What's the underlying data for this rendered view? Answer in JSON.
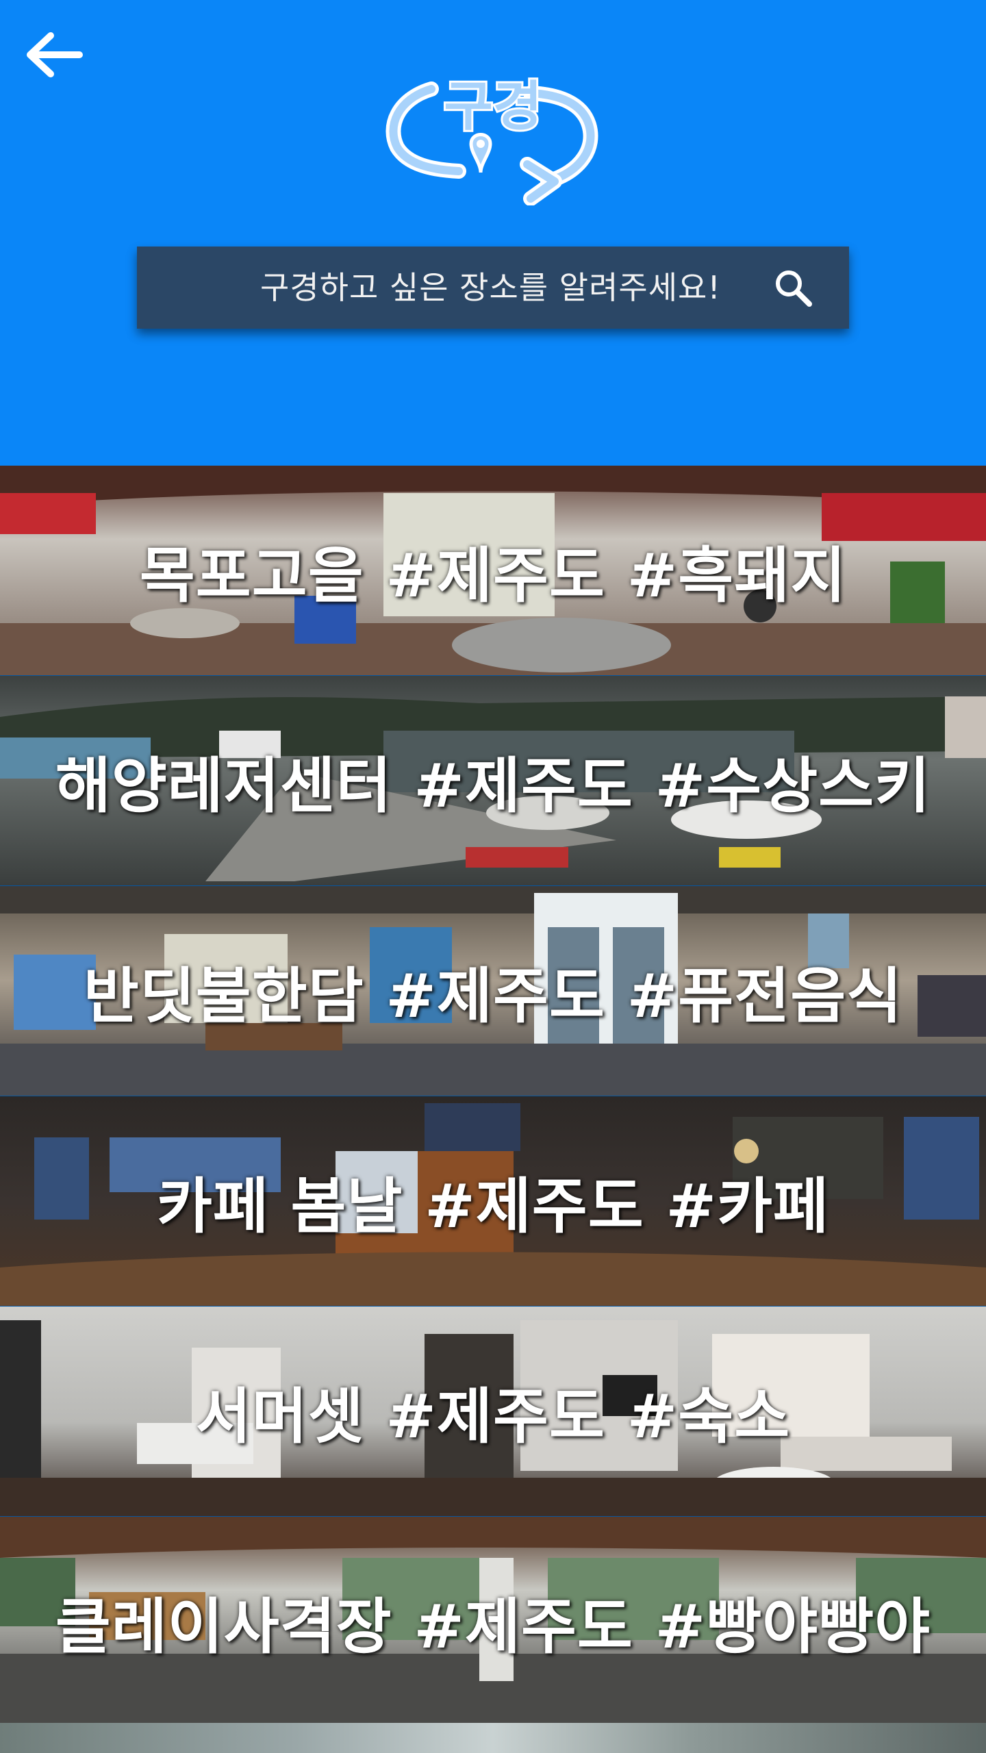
{
  "header": {
    "back_icon": "arrow-left-icon",
    "logo_text": "구경",
    "logo_icon": "map-pin-icon"
  },
  "search": {
    "placeholder": "구경하고 싶은 장소를 알려주세요!",
    "icon": "search-icon"
  },
  "colors": {
    "header_bg": "#0a86f8",
    "search_bg": "#2b4766",
    "logo_light": "#a9d3fb",
    "label_text": "#ffffff"
  },
  "places": [
    {
      "label": "목포고을 #제주도 #흑돼지"
    },
    {
      "label": "해양레저센터 #제주도 #수상스키"
    },
    {
      "label": "반딧불한담 #제주도 #퓨전음식"
    },
    {
      "label": "카페 봄날 #제주도 #카페"
    },
    {
      "label": "서머셋 #제주도 #숙소"
    },
    {
      "label": "클레이사격장 #제주도 #빵야빵야"
    }
  ]
}
